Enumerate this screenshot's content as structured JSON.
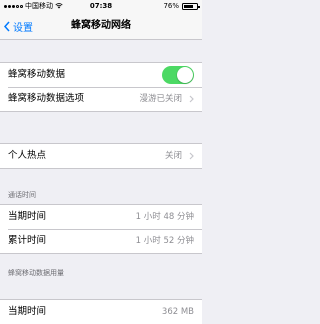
{
  "status_bar": {
    "carrier": "中国移动",
    "time": "07:38",
    "battery_percent": "76%",
    "battery_level": 0.76
  },
  "nav": {
    "back_label": "设置",
    "title": "蜂窝移动网络"
  },
  "cellular": {
    "data_label": "蜂窝移动数据",
    "data_enabled": true,
    "options_label": "蜂窝移动数据选项",
    "options_value": "漫游已关闭"
  },
  "hotspot": {
    "label": "个人热点",
    "value": "关闭"
  },
  "call_time": {
    "header": "通话时间",
    "current_label": "当期时间",
    "current_value": "1 小时 48 分钟",
    "total_label": "累计时间",
    "total_value": "1 小时 52 分钟"
  },
  "usage": {
    "header": "蜂窝移动数据用量",
    "current_label": "当期时间",
    "current_value": "362 MB"
  },
  "colors": {
    "accent": "#007aff",
    "toggle_on": "#4cd964",
    "background": "#efeff4"
  }
}
